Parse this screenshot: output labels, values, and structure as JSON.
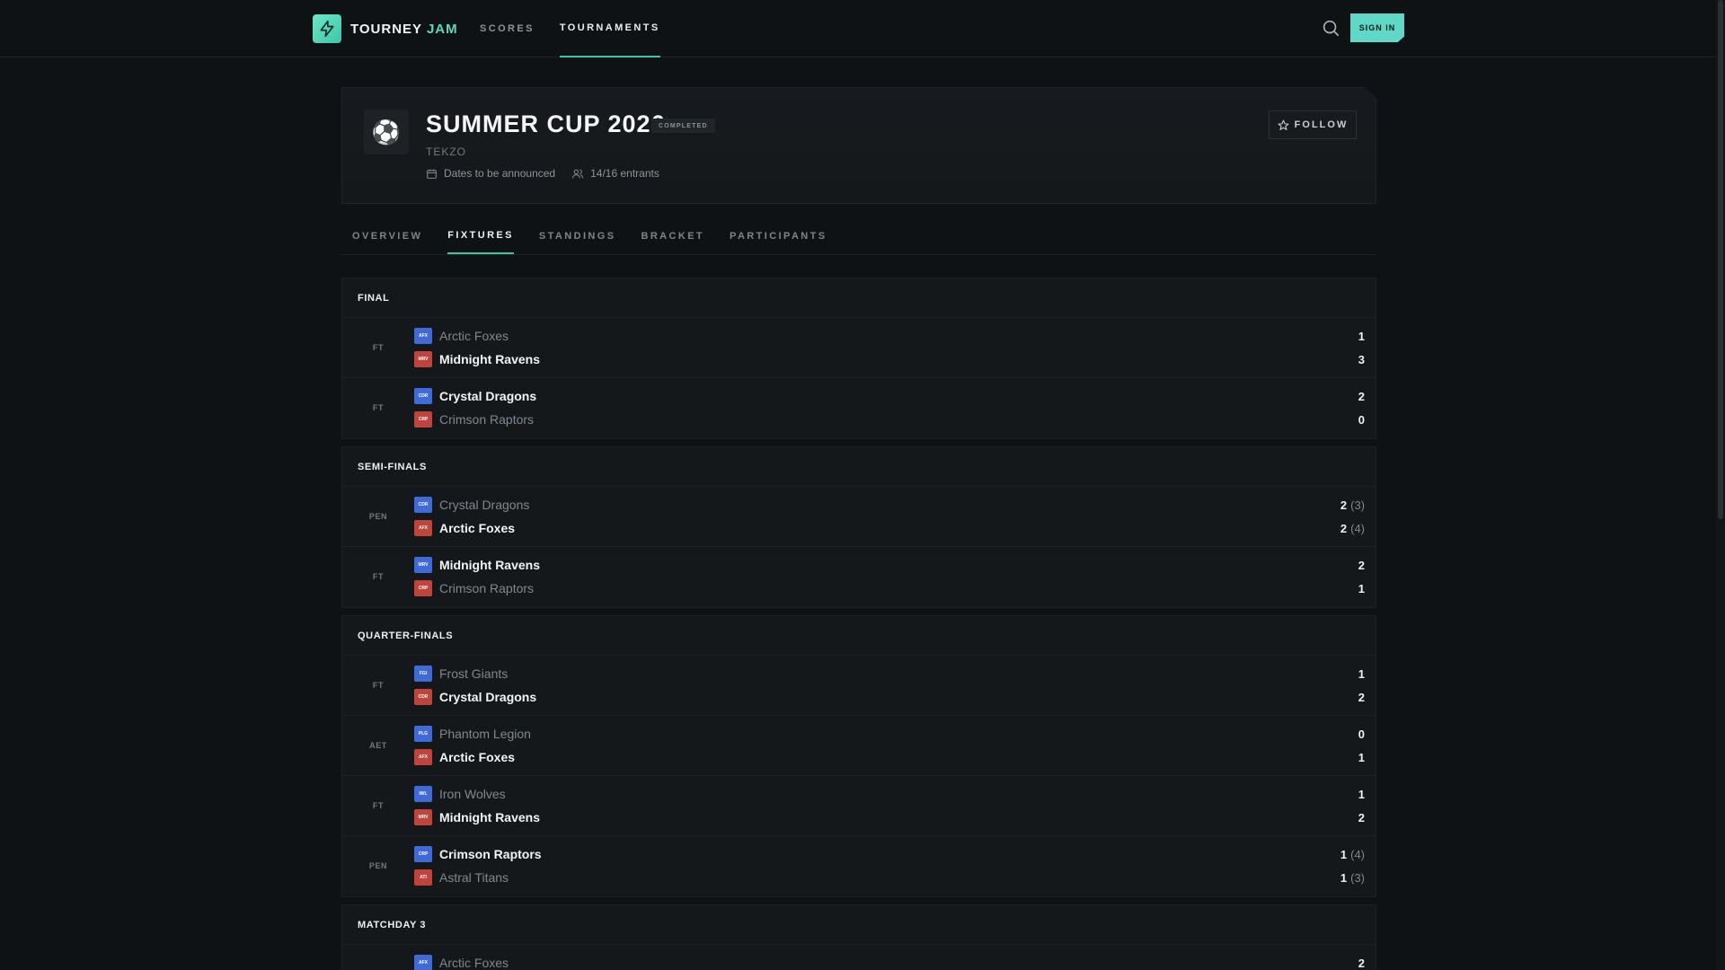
{
  "brand": {
    "name": "TOURNEY",
    "accent": "JAM",
    "accent_color": "#5fd8b8"
  },
  "nav": [
    {
      "label": "SCORES"
    },
    {
      "label": "TOURNAMENTS"
    }
  ],
  "header_actions": {
    "search_icon": "search-icon",
    "sign_in_label": "SIGN IN"
  },
  "tournament": {
    "icon": "⚽",
    "title": "SUMMER CUP 2026",
    "status": "COMPLETED",
    "organizer": "TEKZO",
    "dates": "Dates to be announced",
    "entrants": "14/16 entrants",
    "follow_label": "FOLLOW"
  },
  "tabs": [
    {
      "label": "OVERVIEW"
    },
    {
      "label": "FIXTURES"
    },
    {
      "label": "STANDINGS"
    },
    {
      "label": "BRACKET"
    },
    {
      "label": "PARTICIPANTS"
    }
  ],
  "sections": [
    {
      "title": "FINAL",
      "matches": [
        {
          "status": "FT",
          "home": {
            "abbr": "AFX",
            "name": "Arctic Foxes",
            "score": "1",
            "pens": "",
            "winner": false
          },
          "away": {
            "abbr": "MRV",
            "name": "Midnight Ravens",
            "score": "3",
            "pens": "",
            "winner": true
          }
        },
        {
          "status": "FT",
          "home": {
            "abbr": "CDR",
            "name": "Crystal Dragons",
            "score": "2",
            "pens": "",
            "winner": true
          },
          "away": {
            "abbr": "CRP",
            "name": "Crimson Raptors",
            "score": "0",
            "pens": "",
            "winner": false
          }
        }
      ]
    },
    {
      "title": "SEMI-FINALS",
      "matches": [
        {
          "status": "PEN",
          "home": {
            "abbr": "CDR",
            "name": "Crystal Dragons",
            "score": "2",
            "pens": "(3)",
            "winner": false
          },
          "away": {
            "abbr": "AFX",
            "name": "Arctic Foxes",
            "score": "2",
            "pens": "(4)",
            "winner": true
          }
        },
        {
          "status": "FT",
          "home": {
            "abbr": "MRV",
            "name": "Midnight Ravens",
            "score": "2",
            "pens": "",
            "winner": true
          },
          "away": {
            "abbr": "CRP",
            "name": "Crimson Raptors",
            "score": "1",
            "pens": "",
            "winner": false
          }
        }
      ]
    },
    {
      "title": "QUARTER-FINALS",
      "matches": [
        {
          "status": "FT",
          "home": {
            "abbr": "FGI",
            "name": "Frost Giants",
            "score": "1",
            "pens": "",
            "winner": false
          },
          "away": {
            "abbr": "CDR",
            "name": "Crystal Dragons",
            "score": "2",
            "pens": "",
            "winner": true
          }
        },
        {
          "status": "AET",
          "home": {
            "abbr": "PLG",
            "name": "Phantom Legion",
            "score": "0",
            "pens": "",
            "winner": false
          },
          "away": {
            "abbr": "AFX",
            "name": "Arctic Foxes",
            "score": "1",
            "pens": "",
            "winner": true
          }
        },
        {
          "status": "FT",
          "home": {
            "abbr": "IWL",
            "name": "Iron Wolves",
            "score": "1",
            "pens": "",
            "winner": false
          },
          "away": {
            "abbr": "MRV",
            "name": "Midnight Ravens",
            "score": "2",
            "pens": "",
            "winner": true
          }
        },
        {
          "status": "PEN",
          "home": {
            "abbr": "CRP",
            "name": "Crimson Raptors",
            "score": "1",
            "pens": "(4)",
            "winner": true
          },
          "away": {
            "abbr": "ATI",
            "name": "Astral Titans",
            "score": "1",
            "pens": "(3)",
            "winner": false
          }
        }
      ]
    },
    {
      "title": "MATCHDAY 3",
      "matches": [
        {
          "status": "",
          "home": {
            "abbr": "AFX",
            "name": "Arctic Foxes",
            "score": "2",
            "pens": "",
            "winner": false
          },
          "away": null
        }
      ]
    }
  ]
}
